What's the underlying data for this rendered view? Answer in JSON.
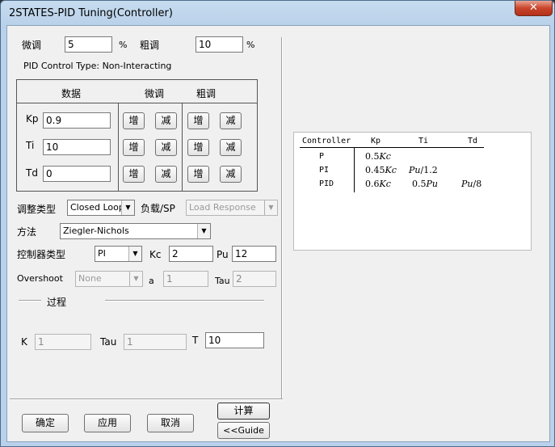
{
  "window": {
    "title": "2STATES-PID Tuning(Controller)",
    "close_symbol": "✕"
  },
  "fine": {
    "label": "微调",
    "value": "5",
    "unit": "%"
  },
  "coarse": {
    "label": "粗调",
    "value": "10",
    "unit": "%"
  },
  "control_type_text": "PID Control Type: Non-Interacting",
  "param_table": {
    "headers": [
      "数据",
      "微调",
      "粗调"
    ],
    "inc_label": "增",
    "dec_label": "减",
    "rows": [
      {
        "name": "Kp",
        "value": "0.9"
      },
      {
        "name": "Ti",
        "value": "10"
      },
      {
        "name": "Td",
        "value": "0"
      }
    ]
  },
  "adjust_type": {
    "label": "调整类型",
    "value": "Closed Loop"
  },
  "load_sp": {
    "label": "负载/SP",
    "value": "Load Response"
  },
  "method": {
    "label": "方法",
    "value": "Ziegler-Nichols"
  },
  "controller_type": {
    "label": "控制器类型",
    "value": "PI"
  },
  "kc": {
    "label": "Kc",
    "value": "2"
  },
  "pu": {
    "label": "Pu",
    "value": "12"
  },
  "overshoot": {
    "label": "Overshoot",
    "value": "None"
  },
  "a": {
    "label": "a",
    "value": "1"
  },
  "tau_top": {
    "label": "Tau",
    "value": "2"
  },
  "process": {
    "label": "过程"
  },
  "k": {
    "label": "K",
    "value": "1"
  },
  "tau_bottom": {
    "label": "Tau",
    "value": "1"
  },
  "t": {
    "label": "T",
    "value": "10"
  },
  "buttons": {
    "ok": "确定",
    "apply": "应用",
    "cancel": "取消",
    "compute": "计算",
    "guide": "<<Guide"
  },
  "formula_table": {
    "headers": [
      "Controller",
      "Kp",
      "Ti",
      "Td"
    ],
    "rows": [
      {
        "controller": "P",
        "kp_num": "0.5",
        "kp_var": "Kc",
        "ti_var": "",
        "ti_rest": "",
        "td_var": "",
        "td_rest": ""
      },
      {
        "controller": "PI",
        "kp_num": "0.45",
        "kp_var": "Kc",
        "ti_var": "Pu",
        "ti_rest": "/1.2",
        "td_var": "",
        "td_rest": ""
      },
      {
        "controller": "PID",
        "kp_num": "0.6",
        "kp_var": "Kc",
        "ti_var": "0.5",
        "ti_rest": "Pu",
        "td_var": "Pu",
        "td_rest": "/8"
      }
    ]
  }
}
